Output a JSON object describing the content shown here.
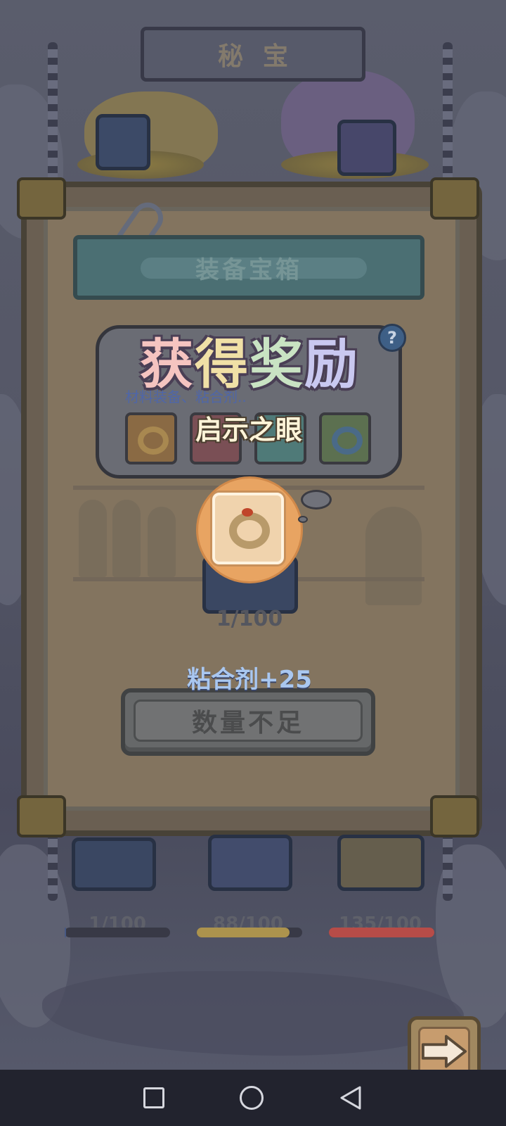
{
  "header": {
    "title": "秘宝"
  },
  "board": {
    "banner_title": "装备宝箱",
    "progress_label": "1/100",
    "action_button_label": "数量不足"
  },
  "chests": [
    {
      "count": "1/100",
      "fill": 0.01,
      "color": "#4a5d8a"
    },
    {
      "count": "88/100",
      "fill": 0.88,
      "color": "#b59a50"
    },
    {
      "count": "135/100",
      "fill": 1.0,
      "color": "#c0504a"
    }
  ],
  "popup": {
    "title": "获得奖励",
    "help_label": "?",
    "hidden_subtitle": "材料装备、粘合剂..",
    "item_name": "启示之眼",
    "reward_amount": "粘合剂+25"
  },
  "icons": {
    "help": "question-mark-icon",
    "reward_item": "ring-icon",
    "next": "arrow-right-icon"
  },
  "colors": {
    "orb": "#e8a462",
    "reward_text": "#a9c7f0"
  }
}
